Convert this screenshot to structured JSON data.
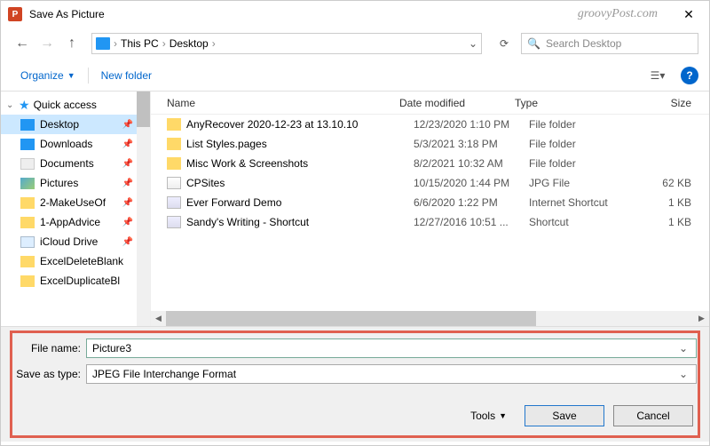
{
  "title": "Save As Picture",
  "watermark": "groovyPost.com",
  "breadcrumb": {
    "items": [
      "This PC",
      "Desktop"
    ]
  },
  "search": {
    "placeholder": "Search Desktop"
  },
  "toolbar": {
    "organize": "Organize",
    "newFolder": "New folder"
  },
  "tree": {
    "root": "Quick access",
    "items": [
      {
        "label": "Desktop",
        "icon": "blue",
        "pinned": true,
        "selected": true
      },
      {
        "label": "Downloads",
        "icon": "blue",
        "pinned": true
      },
      {
        "label": "Documents",
        "icon": "doc",
        "pinned": true
      },
      {
        "label": "Pictures",
        "icon": "pic",
        "pinned": true
      },
      {
        "label": "2-MakeUseOf",
        "icon": "folder",
        "pinned": true
      },
      {
        "label": "1-AppAdvice",
        "icon": "folder",
        "pinned": true
      },
      {
        "label": "iCloud Drive",
        "icon": "cloud",
        "pinned": true
      },
      {
        "label": "ExcelDeleteBlank",
        "icon": "folder",
        "pinned": false
      },
      {
        "label": "ExcelDuplicateBl",
        "icon": "folder",
        "pinned": false
      }
    ]
  },
  "columns": {
    "name": "Name",
    "date": "Date modified",
    "type": "Type",
    "size": "Size"
  },
  "files": [
    {
      "name": "AnyRecover 2020-12-23 at 13.10.10",
      "date": "12/23/2020 1:10 PM",
      "type": "File folder",
      "size": "",
      "icon": "folder"
    },
    {
      "name": "List Styles.pages",
      "date": "5/3/2021 3:18 PM",
      "type": "File folder",
      "size": "",
      "icon": "pages"
    },
    {
      "name": "Misc Work & Screenshots",
      "date": "8/2/2021 10:32 AM",
      "type": "File folder",
      "size": "",
      "icon": "folder"
    },
    {
      "name": "CPSites",
      "date": "10/15/2020 1:44 PM",
      "type": "JPG File",
      "size": "62 KB",
      "icon": "jpg"
    },
    {
      "name": "Ever Forward Demo",
      "date": "6/6/2020 1:22 PM",
      "type": "Internet Shortcut",
      "size": "1 KB",
      "icon": "url"
    },
    {
      "name": "Sandy's Writing - Shortcut",
      "date": "12/27/2016 10:51 ...",
      "type": "Shortcut",
      "size": "1 KB",
      "icon": "url"
    }
  ],
  "form": {
    "fileNameLabel": "File name:",
    "fileName": "Picture3",
    "saveTypeLabel": "Save as type:",
    "saveType": "JPEG File Interchange Format",
    "tools": "Tools",
    "save": "Save",
    "cancel": "Cancel"
  }
}
